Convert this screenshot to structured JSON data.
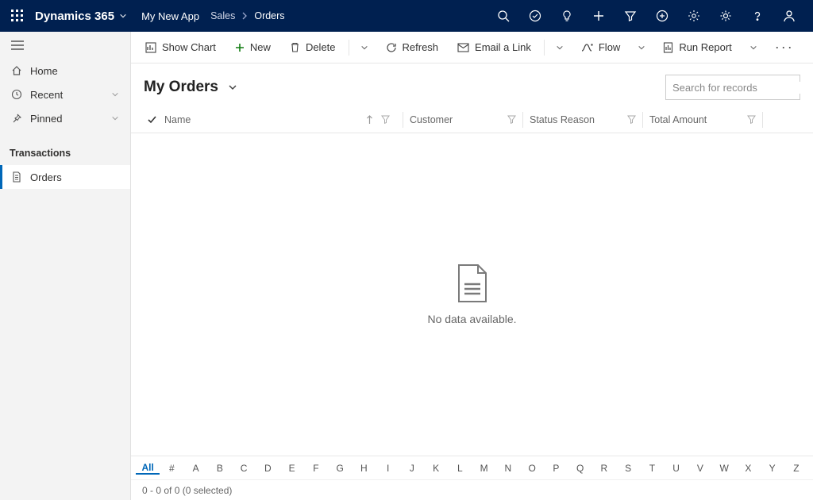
{
  "header": {
    "brand": "Dynamics 365",
    "app_name": "My New App",
    "breadcrumb": {
      "area": "Sales",
      "page": "Orders"
    }
  },
  "sidebar": {
    "home": "Home",
    "recent": "Recent",
    "pinned": "Pinned",
    "section": "Transactions",
    "items": [
      {
        "label": "Orders",
        "selected": true
      }
    ]
  },
  "commands": {
    "show_chart": "Show Chart",
    "new": "New",
    "delete": "Delete",
    "refresh": "Refresh",
    "email_link": "Email a Link",
    "flow": "Flow",
    "run_report": "Run Report"
  },
  "view": {
    "title": "My Orders",
    "search_placeholder": "Search for records"
  },
  "grid": {
    "columns": {
      "name": "Name",
      "customer": "Customer",
      "status_reason": "Status Reason",
      "total_amount": "Total Amount"
    },
    "empty_message": "No data available."
  },
  "alpha_filter": [
    "All",
    "#",
    "A",
    "B",
    "C",
    "D",
    "E",
    "F",
    "G",
    "H",
    "I",
    "J",
    "K",
    "L",
    "M",
    "N",
    "O",
    "P",
    "Q",
    "R",
    "S",
    "T",
    "U",
    "V",
    "W",
    "X",
    "Y",
    "Z"
  ],
  "footer": {
    "status": "0 - 0 of 0 (0 selected)"
  }
}
